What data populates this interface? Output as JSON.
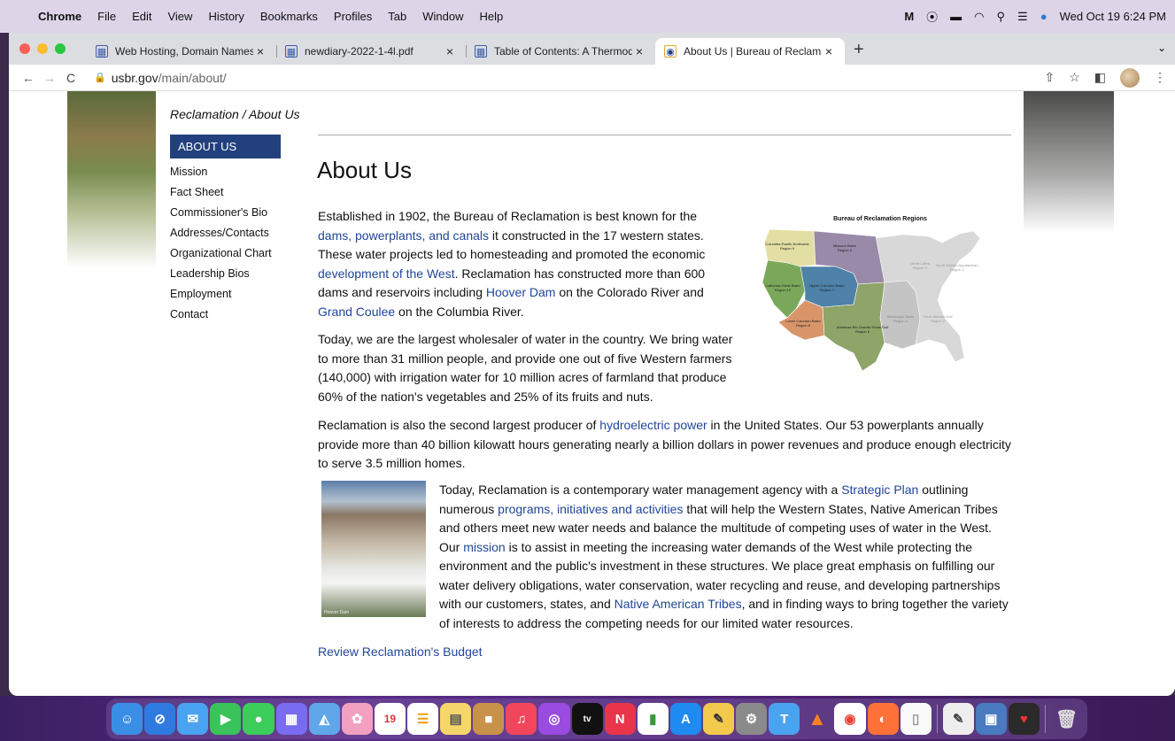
{
  "menubar": {
    "apple": "",
    "items": [
      "Chrome",
      "File",
      "Edit",
      "View",
      "History",
      "Bookmarks",
      "Profiles",
      "Tab",
      "Window",
      "Help"
    ],
    "clock": "Wed Oct 19  6:24 PM"
  },
  "tabs": [
    {
      "title": "Web Hosting, Domain Names, ",
      "icon": "grid-icon"
    },
    {
      "title": "newdiary-2022-1-4l.pdf",
      "icon": "grid-icon"
    },
    {
      "title": "Table of Contents: A Thermody",
      "icon": "grid-icon"
    },
    {
      "title": "About Us | Bureau of Reclamat",
      "icon": "reclamation-icon",
      "active": true
    }
  ],
  "toolbar": {
    "domain": "usbr.gov",
    "path": "/main/about/"
  },
  "page": {
    "breadcrumb": "Reclamation / About Us",
    "nav_head": "ABOUT US",
    "nav_items": [
      "Mission",
      "Fact Sheet",
      "Commissioner's Bio",
      "Addresses/Contacts",
      "Organizational Chart",
      "Leadership Bios",
      "Employment",
      "Contact"
    ],
    "title": "About Us",
    "p1": {
      "t1": "Established in 1902, the Bureau of Reclamation is best known for the ",
      "l1": "dams, powerplants, and canals",
      "t2": " it constructed in the 17 western states. These water projects led to homesteading and promoted the economic ",
      "l2": "development of the West",
      "t3": ". Reclamation has constructed more than 600 dams and reservoirs including ",
      "l3": "Hoover Dam",
      "t4": " on the Colorado River and ",
      "l4": "Grand Coulee",
      "t5": " on the Columbia River."
    },
    "p2": "Today, we are the largest wholesaler of water in the country. We bring water to more than 31 million people, and provide one out of five Western farmers (140,000) with irrigation water for 10 million acres of farmland that produce 60% of the nation's vegetables and 25% of its fruits and nuts.",
    "p3": {
      "t1": "Reclamation is also the second largest producer of ",
      "l1": "hydroelectric power",
      "t2": " in the United States. Our 53 powerplants annually provide more than 40 billion kilowatt hours generating nearly a billion dollars in power revenues and produce enough electricity to serve 3.5 million homes."
    },
    "p4": {
      "t1": "Today, Reclamation is a contemporary water management agency with a ",
      "l1": "Strategic Plan",
      "t2": " outlining numerous ",
      "l2": "programs, initiatives and activities",
      "t3": " that will help the Western States, Native American Tribes and others meet new water needs and balance the multitude of competing uses of water in the West. Our ",
      "l3": "mission",
      "t4": " is to assist in meeting the increasing water demands of the West while protecting the environment and the public's investment in these structures. We place great emphasis on fulfilling our water delivery obligations, water conservation, water recycling and reuse, and developing partnerships with our customers, states, and ",
      "l4": "Native American Tribes",
      "t5": ", and in finding ways to bring together the variety of interests to address the competing needs for our limited water resources."
    },
    "budget_link": "Review Reclamation's Budget",
    "map": {
      "title": "Bureau of Reclamation Regions",
      "regions": [
        {
          "name": "Columbia-Pacific Northwest",
          "sub": "Region 9",
          "color": "#e3dfa4"
        },
        {
          "name": "Missouri Basin",
          "sub": "Region 5",
          "color": "#9a8aa9"
        },
        {
          "name": "California-Great Basin",
          "sub": "Region 10",
          "color": "#7aa85a"
        },
        {
          "name": "Upper Colorado Basin",
          "sub": "Region 7",
          "color": "#4e82a8"
        },
        {
          "name": "Lower Colorado Basin",
          "sub": "Region 8",
          "color": "#d9956a"
        },
        {
          "name": "Arkansas-Rio Grande-Texas Gulf",
          "sub": "Region 6",
          "color": "#8ea468"
        },
        {
          "name": "Great Lakes",
          "sub": "Region 3"
        },
        {
          "name": "North Atlantic-Appalachian",
          "sub": "Region 1"
        },
        {
          "name": "Mississippi Basin",
          "sub": "Region 4"
        },
        {
          "name": "South Atlantic-Gulf",
          "sub": "Region 2"
        }
      ]
    },
    "photo_caption": "Hoover Dam"
  }
}
